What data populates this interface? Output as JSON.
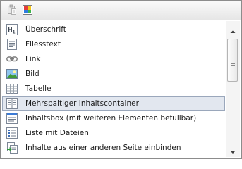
{
  "toolbar": {
    "buttons": [
      {
        "icon": "paste-icon"
      },
      {
        "icon": "color-palette-icon"
      }
    ]
  },
  "list": {
    "items": [
      {
        "label": "Überschrift",
        "icon": "heading-icon",
        "selected": false
      },
      {
        "label": "Fliesstext",
        "icon": "text-document-icon",
        "selected": false
      },
      {
        "label": "Link",
        "icon": "link-icon",
        "selected": false
      },
      {
        "label": "Bild",
        "icon": "image-icon",
        "selected": false
      },
      {
        "label": "Tabelle",
        "icon": "table-icon",
        "selected": false
      },
      {
        "label": "Mehrspaltiger Inhaltscontainer",
        "icon": "columns-icon",
        "selected": true
      },
      {
        "label": "Inhaltsbox (mit weiteren Elementen befüllbar)",
        "icon": "content-box-icon",
        "selected": false
      },
      {
        "label": "Liste mit Dateien",
        "icon": "file-list-icon",
        "selected": false
      },
      {
        "label": "Inhalte aus einer anderen Seite einbinden",
        "icon": "embed-page-icon",
        "selected": false
      }
    ]
  },
  "scrollbar": {
    "up_icon": "scroll-up-arrow-icon",
    "down_icon": "scroll-down-arrow-icon"
  }
}
